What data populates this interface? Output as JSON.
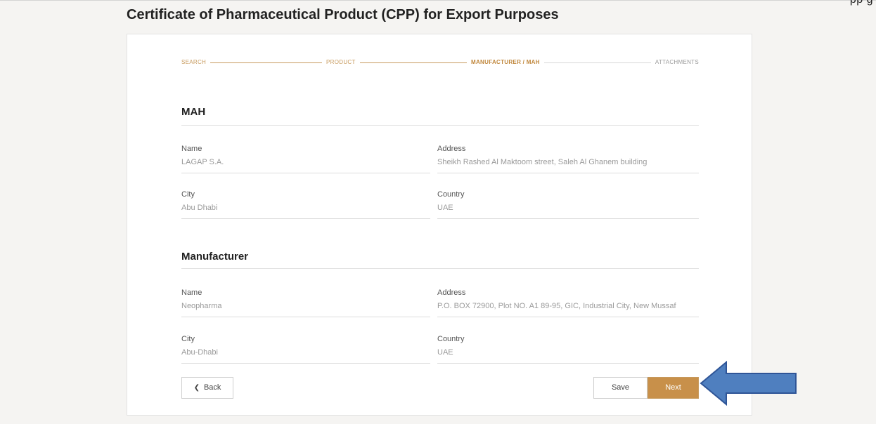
{
  "page": {
    "title": "Certificate of Pharmaceutical Product (CPP) for Export Purposes",
    "top_fragment": "pp g"
  },
  "stepper": {
    "steps": [
      {
        "label": "SEARCH",
        "state": "done"
      },
      {
        "label": "PRODUCT",
        "state": "done"
      },
      {
        "label": "MANUFACTURER / MAH",
        "state": "active"
      },
      {
        "label": "ATTACHMENTS",
        "state": "todo"
      }
    ]
  },
  "mah": {
    "heading": "MAH",
    "name_label": "Name",
    "name_value": "LAGAP S.A.",
    "address_label": "Address",
    "address_value": "Sheikh Rashed Al Maktoom street, Saleh Al Ghanem building",
    "city_label": "City",
    "city_value": "Abu Dhabi",
    "country_label": "Country",
    "country_value": "UAE"
  },
  "manufacturer": {
    "heading": "Manufacturer",
    "name_label": "Name",
    "name_value": "Neopharma",
    "address_label": "Address",
    "address_value": "P.O. BOX 72900, Plot NO. A1 89-95, GIC, Industrial City, New Mussaf",
    "city_label": "City",
    "city_value": "Abu-Dhabi",
    "country_label": "Country",
    "country_value": "UAE"
  },
  "actions": {
    "back_label": "Back",
    "back_icon": "chevron-left-icon",
    "save_label": "Save",
    "next_label": "Next"
  },
  "colors": {
    "accent": "#c8904a",
    "step_done": "#c79a5d",
    "annotation_arrow": "#4f7fbf"
  }
}
